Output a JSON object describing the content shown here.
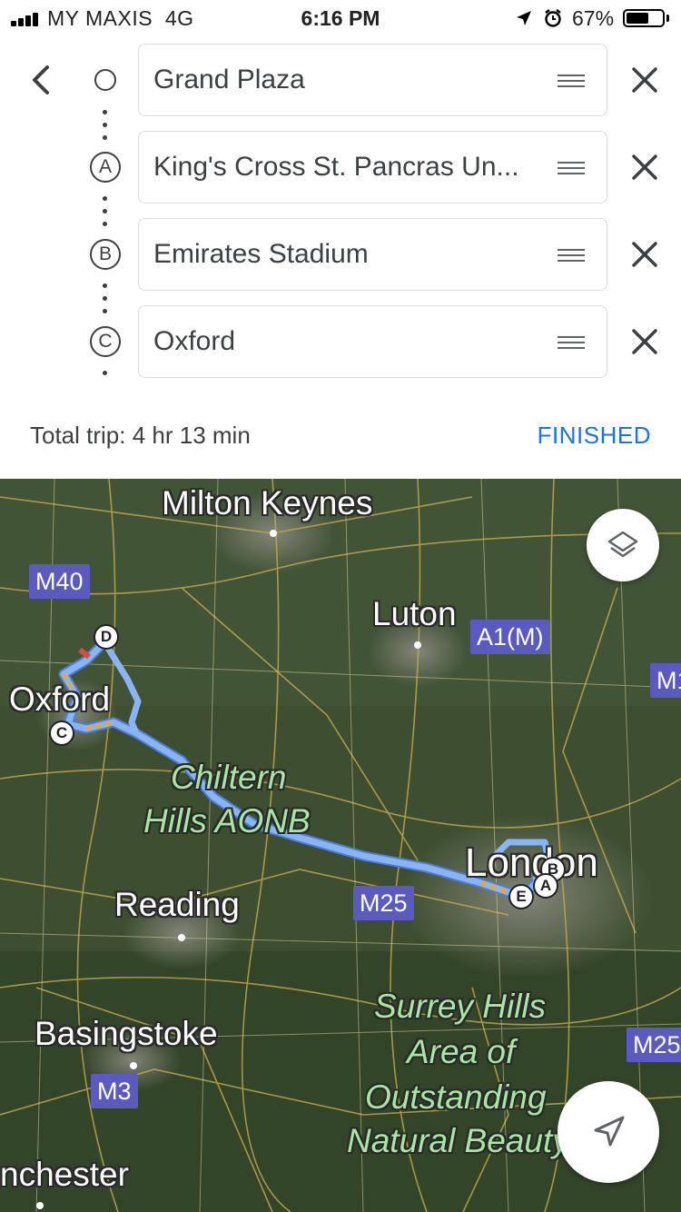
{
  "status_bar": {
    "carrier": "MY MAXIS",
    "network": "4G",
    "time": "6:16 PM",
    "battery_percent": "67%",
    "battery_level": 0.67
  },
  "route": {
    "origin": {
      "marker": "",
      "text": "Grand Plaza"
    },
    "stops": [
      {
        "marker": "A",
        "text": "King's Cross St. Pancras Un..."
      },
      {
        "marker": "B",
        "text": "Emirates Stadium"
      },
      {
        "marker": "C",
        "text": "Oxford"
      }
    ],
    "total_trip": "Total trip: 4 hr 13 min",
    "finished_label": "FINISHED"
  },
  "map": {
    "places": [
      "Milton Keynes",
      "Luton",
      "Oxford",
      "Reading",
      "Basingstoke",
      "nchester",
      "London"
    ],
    "areas": [
      "Chiltern",
      "Hills AONB",
      "Surrey Hills",
      "Area of",
      "Outstanding",
      "Natural Beauty"
    ],
    "roads": [
      "M40",
      "A1(M)",
      "M1",
      "M25",
      "M3",
      "M25"
    ],
    "pins": [
      "D",
      "C",
      "B",
      "A",
      "E"
    ],
    "route_color": "#8ab4f8"
  },
  "icons": {
    "layers": "layers-icon",
    "navigate": "navigate-icon",
    "back": "chevron-left-icon",
    "remove": "close-icon",
    "drag": "drag-handle-icon"
  }
}
